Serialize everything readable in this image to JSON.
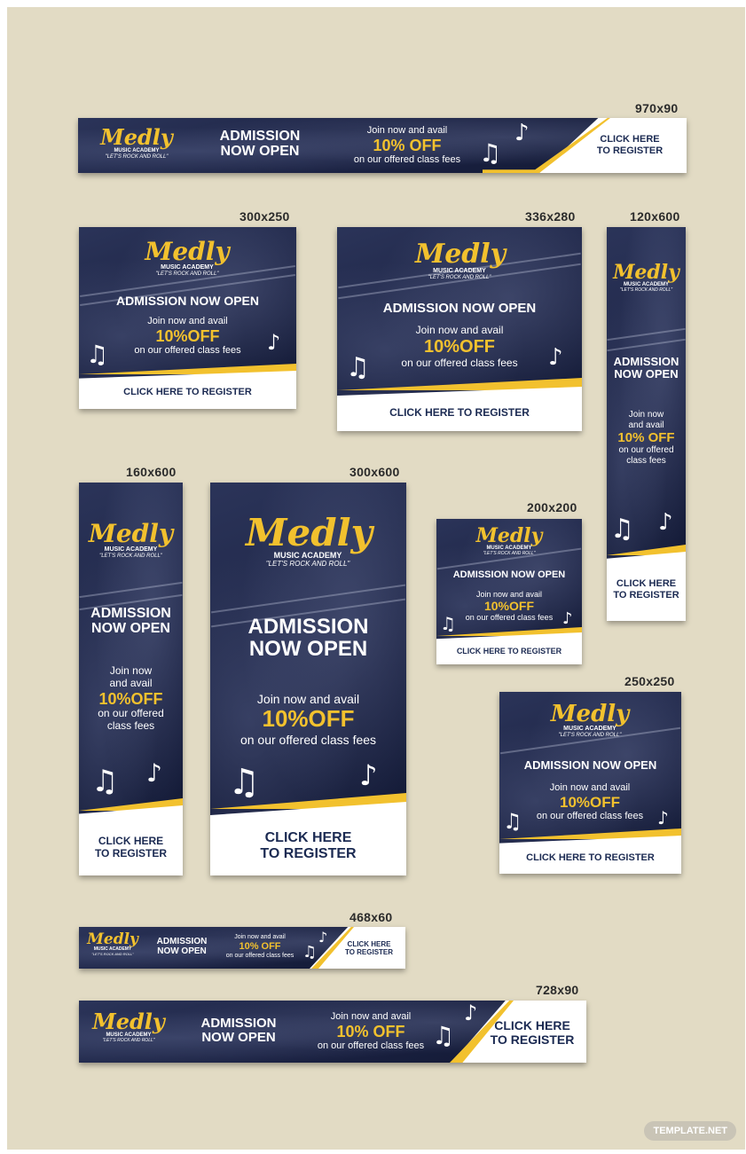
{
  "brand": {
    "name": "Medly",
    "subtitle": "MUSIC ACADEMY",
    "tagline": "\"LET'S ROCK AND ROLL\""
  },
  "copy": {
    "admission": "ADMISSION NOW OPEN",
    "admission_line1": "ADMISSION",
    "admission_line2": "NOW OPEN",
    "join": "Join now and avail",
    "join_line1": "Join now",
    "join_line2": "and avail",
    "discount_spaced": "10% OFF",
    "discount": "10%OFF",
    "fees": "on our offered class fees",
    "fees_line1": "on our offered",
    "fees_line2": "class fees",
    "cta": "CLICK HERE TO REGISTER",
    "cta_line1": "CLICK HERE",
    "cta_line2": "TO REGISTER"
  },
  "sizes": {
    "s970x90": "970x90",
    "s300x250": "300x250",
    "s336x280": "336x280",
    "s120x600": "120x600",
    "s160x600": "160x600",
    "s300x600": "300x600",
    "s200x200": "200x200",
    "s250x250": "250x250",
    "s468x60": "468x60",
    "s728x90": "728x90"
  },
  "footer": {
    "badge": "TEMPLATE.NET"
  },
  "colors": {
    "background": "#e2dbc4",
    "banner_navy": "#1b2340",
    "accent_yellow": "#f2c12e",
    "cta_text": "#1b2a52"
  },
  "icons": [
    "music-note-icon",
    "double-music-note-icon"
  ]
}
